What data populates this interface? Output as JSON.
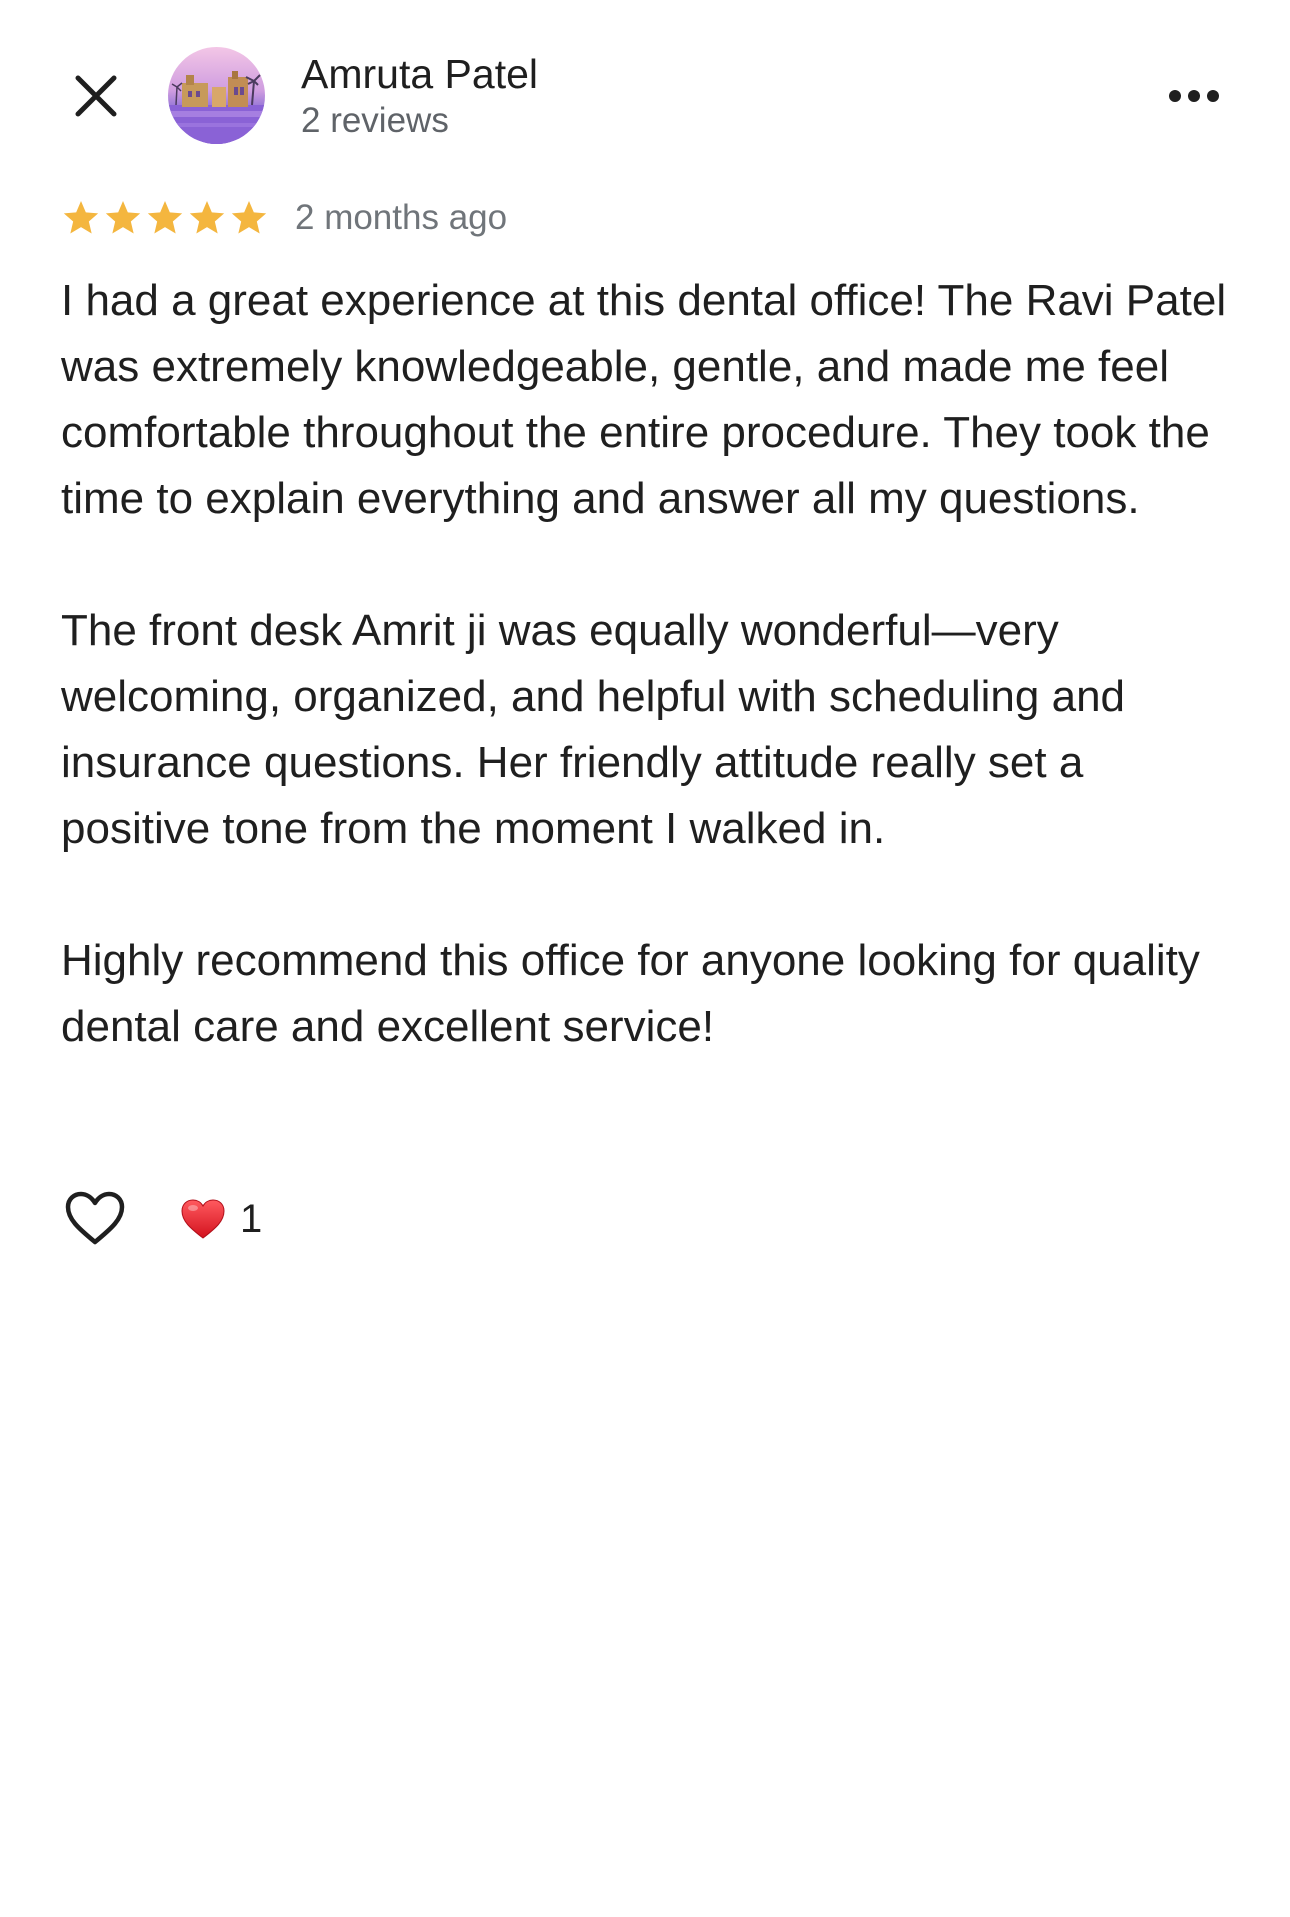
{
  "header": {
    "author_name": "Amruta Patel",
    "author_review_count": "2 reviews",
    "close_icon": "close-icon",
    "more_icon": "more-horizontal-icon"
  },
  "review": {
    "rating": 5,
    "rating_max": 5,
    "date": "2 months ago",
    "paragraphs": [
      "I had a great experience at this dental office! The Ravi Patel was extremely knowledgeable, gentle, and made me feel comfortable throughout the entire procedure. They took the time to explain everything and answer all my questions.",
      "The front desk Amrit ji was equally wonderful—very welcoming, organized, and helpful with scheduling and insurance questions. Her friendly attitude really set a positive tone from the moment I walked in.",
      "Highly recommend this office for anyone looking for quality dental care and excellent service!"
    ]
  },
  "reactions": {
    "like_icon": "heart-outline-icon",
    "reaction_icon": "red-heart-icon",
    "count": "1"
  },
  "colors": {
    "star": "#F4B63F",
    "text_primary": "#1F1F1F",
    "text_secondary": "#5F6368",
    "heart_red": "#E0202E",
    "background": "#FFFFFF"
  }
}
